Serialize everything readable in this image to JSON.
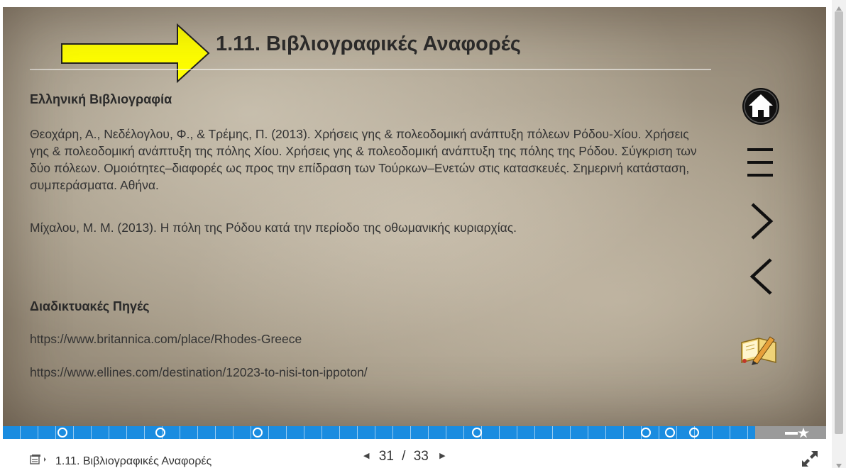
{
  "slide": {
    "title": "1.11. Βιβλιογραφικές Αναφορές",
    "greek_heading": "Ελληνική Βιβλιογραφία",
    "refs": [
      "Θεοχάρη, Α., Νεδέλογλου, Φ., & Τρέμης, Π. (2013). Χρήσεις γης & πολεοδομική ανάπτυξη πόλεων Ρόδου-Χίου. Χρήσεις γης & πολεοδομική ανάπτυξη της πόλης Χίου. Χρήσεις γης & πολεοδομική ανάπτυξη της πόλης της Ρόδου. Σύγκριση των δύο πόλεων. Ομοιότητες–διαφορές ως προς την επίδραση των Τούρκων–Ενετών στις κατασκευές. Σημερινή κατάσταση, συμπεράσματα. Αθήνα.",
      "Μίχαλου, Μ. Μ. (2013). Η πόλη της Ρόδου κατά την περίοδο της οθωμανικής κυριαρχίας."
    ],
    "web_heading": "Διαδικτυακές Πηγές",
    "urls": [
      "https://www.britannica.com/place/Rhodes-Greece",
      "https://www.ellines.com/destination/12023-to-nisi-ton-ippoton/"
    ]
  },
  "side_icons": [
    "home-icon",
    "menu-icon",
    "next-icon",
    "previous-icon",
    "notebook-pencil-icon"
  ],
  "bottom": {
    "toc_label": "1.11. Βιβλιογραφικές Αναφορές",
    "page_current": "31",
    "page_separator": "/",
    "page_total": "33"
  },
  "progress": {
    "current_page": 31,
    "total_pages": 33,
    "fraction": 0.94
  },
  "colors": {
    "progress": "#1a8ce0",
    "arrow_fill": "#ffff00",
    "arrow_stroke": "#222222"
  }
}
